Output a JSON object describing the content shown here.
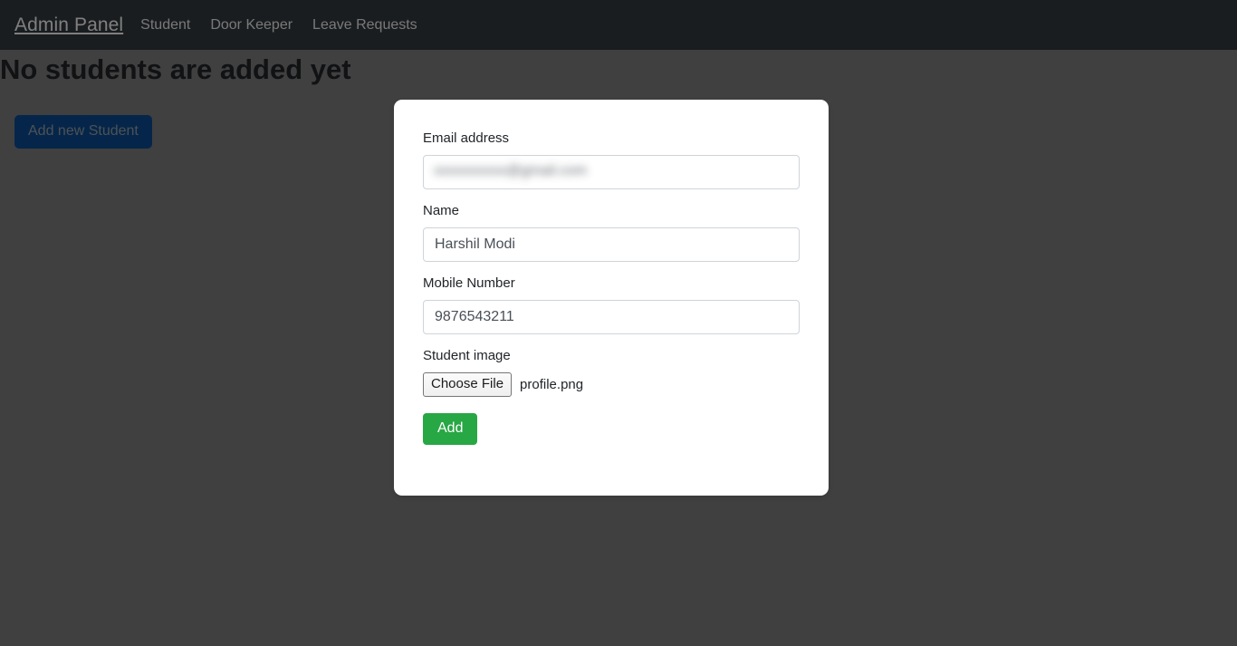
{
  "navbar": {
    "brand": "Admin Panel",
    "links": [
      {
        "label": "Student"
      },
      {
        "label": "Door Keeper"
      },
      {
        "label": "Leave Requests"
      }
    ]
  },
  "page": {
    "title": "No students are added yet",
    "add_student_label": "Add new Student"
  },
  "modal": {
    "fields": {
      "email": {
        "label": "Email address",
        "value": "xxxxxxxxxx@gmail.com",
        "placeholder": ""
      },
      "name": {
        "label": "Name",
        "value": "Harshil Modi",
        "placeholder": ""
      },
      "mobile": {
        "label": "Mobile Number",
        "value": "9876543211",
        "placeholder": ""
      },
      "image": {
        "label": "Student image",
        "choose_file_label": "Choose File",
        "file_name": "profile.png"
      }
    },
    "submit_label": "Add"
  },
  "colors": {
    "navbar_bg": "#343a40",
    "backdrop": "#808080",
    "primary_button": "#0b4d94",
    "success_button": "#28a745",
    "card_bg": "#ffffff",
    "input_border": "#ced4da"
  }
}
